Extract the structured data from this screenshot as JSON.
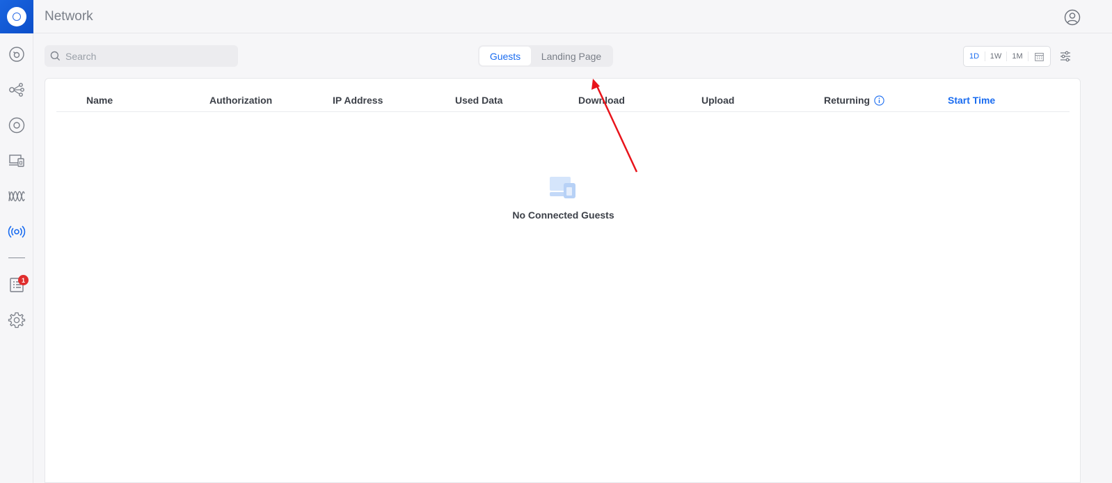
{
  "app": {
    "title": "Network"
  },
  "search": {
    "placeholder": "Search"
  },
  "tabs": [
    {
      "label": "Guests",
      "active": true
    },
    {
      "label": "Landing Page",
      "active": false
    }
  ],
  "time_range": {
    "options": [
      "1D",
      "1W",
      "1M"
    ],
    "selected": "1D"
  },
  "table": {
    "columns": [
      "Name",
      "Authorization",
      "IP Address",
      "Used Data",
      "Download",
      "Upload",
      "Returning",
      "Start Time"
    ],
    "sorted_column": "Start Time",
    "rows": []
  },
  "empty_state": {
    "message": "No Connected Guests"
  },
  "sidebar": {
    "items": [
      {
        "icon": "dashboard-icon"
      },
      {
        "icon": "topology-icon"
      },
      {
        "icon": "devices-icon"
      },
      {
        "icon": "clients-icon"
      },
      {
        "icon": "statistics-icon"
      },
      {
        "icon": "hotspot-icon",
        "active": true
      },
      {
        "icon": "events-icon",
        "badge": "1"
      },
      {
        "icon": "settings-icon"
      }
    ]
  },
  "colors": {
    "accent": "#1a6cf0",
    "badge": "#e02e2e",
    "annotation": "#e8141b"
  }
}
